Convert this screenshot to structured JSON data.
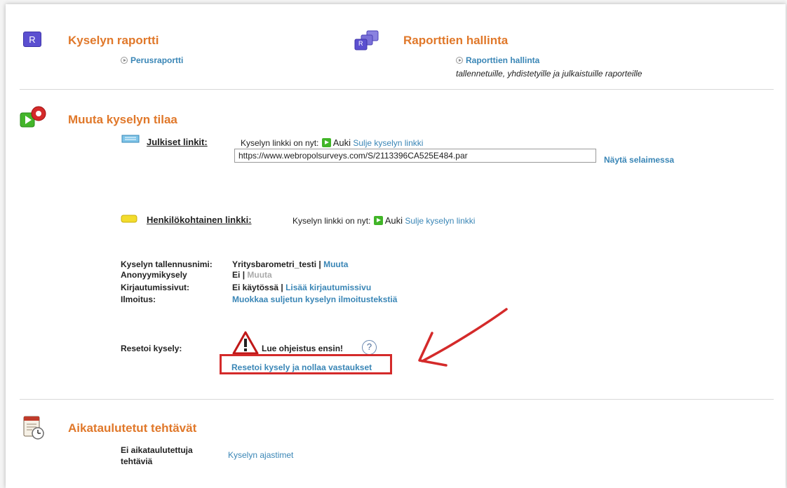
{
  "report": {
    "icon_letter": "R",
    "title": "Kyselyn raportti",
    "basic_report_link": "Perusraportti"
  },
  "report_mgmt": {
    "icon_letter": "R",
    "title": "Raporttien hallinta",
    "link": "Raporttien hallinta",
    "description": "tallennetuille, yhdistetyille ja julkaistuille raporteille"
  },
  "status": {
    "title": "Muuta kyselyn tilaa",
    "public": {
      "label": "Julkiset linkit:",
      "now_text": "Kyselyn linkki on nyt:",
      "state": "Auki",
      "close_link": "Sulje kyselyn linkki",
      "url": "https://www.webropolsurveys.com/S/2113396CA525E484.par",
      "show_browser": "Näytä selaimessa"
    },
    "personal": {
      "label": "Henkilökohtainen linkki:",
      "now_text": "Kyselyn linkki on nyt:",
      "state": "Auki",
      "close_link": "Sulje kyselyn linkki"
    },
    "details": {
      "save_name_label": "Kyselyn tallennusnimi:",
      "save_name_value": "Yritysbarometri_testi",
      "save_name_link": "Muuta",
      "anon_label": "Anonyymikysely",
      "anon_value": "Ei",
      "anon_link": "Muuta",
      "login_label": "Kirjautumissivut:",
      "login_value": "Ei käytössä",
      "login_link": "Lisää kirjautumissivu",
      "notice_label": "Ilmoitus:",
      "notice_link": "Muokkaa suljetun kyselyn ilmoitustekstiä",
      "separator": "|"
    },
    "reset": {
      "label": "Resetoi kysely:",
      "warning": "Lue ohjeistus ensin!",
      "help_glyph": "?",
      "reset_link": "Resetoi kysely ja nollaa vastaukset"
    }
  },
  "scheduled": {
    "title": "Aikataulutetut tehtävät",
    "none_text": "Ei aikataulutettuja tehtäviä",
    "timers_link": "Kyselyn ajastimet"
  },
  "colors": {
    "orange_heading": "#e0782a",
    "link_blue": "#3a86b6",
    "annotation_red": "#d42a2a",
    "open_green": "#41b528"
  }
}
